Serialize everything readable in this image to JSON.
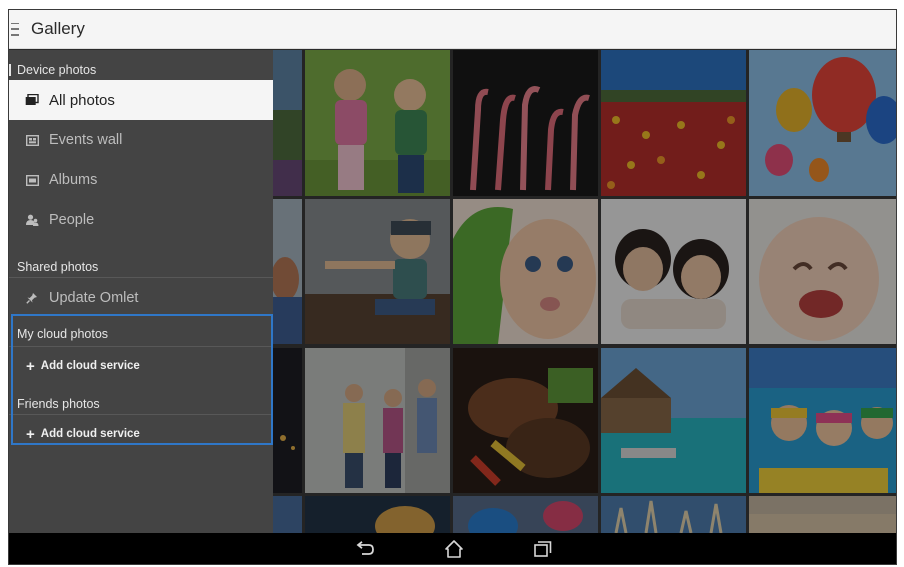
{
  "app": {
    "title": "Gallery"
  },
  "drawer": {
    "device_header": "Device photos",
    "items": [
      {
        "label": "All photos",
        "icon": "photo-stack-icon",
        "active": true
      },
      {
        "label": "Events wall",
        "icon": "events-icon",
        "active": false
      },
      {
        "label": "Albums",
        "icon": "album-icon",
        "active": false
      },
      {
        "label": "People",
        "icon": "people-icon",
        "active": false
      }
    ],
    "shared_header": "Shared photos",
    "update_omlet": {
      "label": "Update Omlet",
      "icon": "pin-icon"
    },
    "cloud_header": "My cloud photos",
    "cloud_add": "Add cloud service",
    "friends_header": "Friends photos",
    "friends_add": "Add cloud service"
  },
  "colors": {
    "drawer_bg": "#444444",
    "active_bg": "#f5f5f5",
    "highlight_border": "#2f77c8",
    "navbar_bg": "#000000"
  },
  "navbar": {
    "icons": [
      "back-icon",
      "home-icon",
      "recent-apps-icon"
    ]
  }
}
